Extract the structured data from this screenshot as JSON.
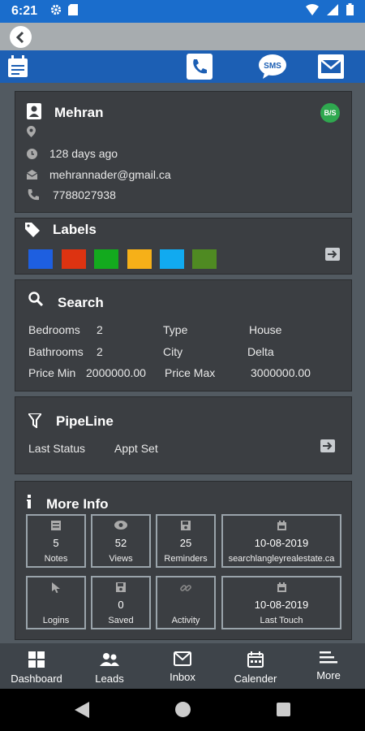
{
  "status_bar": {
    "time": "6:21"
  },
  "contact": {
    "name": "Mehran",
    "badge": "B/S",
    "last_contact": "128 days ago",
    "email": "mehrannader@gmail.ca",
    "phone": "7788027938"
  },
  "labels": {
    "title": "Labels",
    "colors": [
      "#1e5fe0",
      "#dd3311",
      "#13aa1e",
      "#f6b018",
      "#11aaf0",
      "#4f8a22"
    ]
  },
  "search": {
    "title": "Search",
    "bedrooms_label": "Bedrooms",
    "bedrooms": "2",
    "bathrooms_label": "Bathrooms",
    "bathrooms": "2",
    "price_min_label": "Price Min",
    "price_min": "2000000.00",
    "type_label": "Type",
    "type": "House",
    "city_label": "City",
    "city": "Delta",
    "price_max_label": "Price Max",
    "price_max": "3000000.00"
  },
  "pipeline": {
    "title": "PipeLine",
    "status_label": "Last Status",
    "status_value": "Appt Set"
  },
  "more_info": {
    "title": "More Info",
    "notes": {
      "value": "5",
      "label": "Notes"
    },
    "views": {
      "value": "52",
      "label": "Views"
    },
    "reminders": {
      "value": "25",
      "label": "Reminders"
    },
    "source": {
      "value": "10-08-2019",
      "label": "searchlangleyrealestate.ca"
    },
    "logins": {
      "label": "Logins"
    },
    "saved": {
      "value": "0",
      "label": "Saved"
    },
    "activity": {
      "label": "Activity"
    },
    "last_touch": {
      "value": "10-08-2019",
      "label": "Last Touch"
    }
  },
  "bottom_nav": {
    "dashboard": "Dashboard",
    "leads": "Leads",
    "inbox": "Inbox",
    "calender": "Calender",
    "more": "More"
  }
}
